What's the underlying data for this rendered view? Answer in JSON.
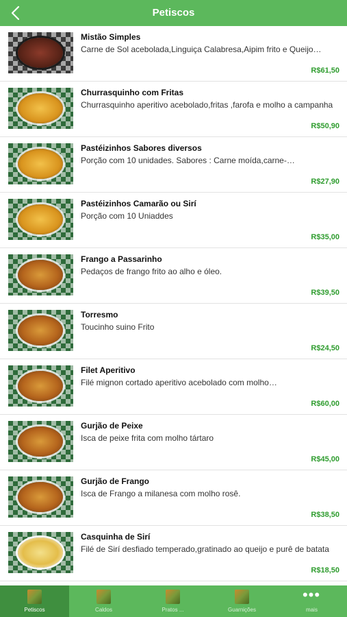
{
  "header": {
    "title": "Petiscos",
    "back_icon": "chevron-left-icon"
  },
  "items": [
    {
      "title": "Mistão Simples",
      "description": "Carne de Sol acebolada,Linguiça Calabresa,Aipim frito e Queijo…",
      "price": "R$61,50"
    },
    {
      "title": "Churrasquinho com Fritas",
      "description": "Churrasquinho aperitivo acebolado,fritas ,farofa e molho a campanha",
      "price": "R$50,90"
    },
    {
      "title": "Pastéizinhos Sabores diversos",
      "description": "Porção com 10 unidades. Sabores : Carne moída,carne-…",
      "price": "R$27,90"
    },
    {
      "title": "Pastéizinhos Camarão ou Sirí",
      "description": "Porção com 10 Uniaddes",
      "price": "R$35,00"
    },
    {
      "title": "Frango a Passarinho",
      "description": "Pedaços de frango frito ao alho e óleo.",
      "price": "R$39,50"
    },
    {
      "title": "Torresmo",
      "description": "Toucinho suino Frito",
      "price": "R$24,50"
    },
    {
      "title": "Filet Aperitivo",
      "description": "Filé mignon cortado aperitivo acebolado com molho…",
      "price": "R$60,00"
    },
    {
      "title": "Gurjão de Peixe",
      "description": "Isca de peixe frita com molho tártaro",
      "price": "R$45,00"
    },
    {
      "title": "Gurjão de Frango",
      "description": "Isca de Frango a milanesa com molho rosê.",
      "price": "R$38,50"
    },
    {
      "title": "Casquinha de Sirí",
      "description": "Filé de Sirí desfiado temperado,gratinado ao queijo e purê de batata",
      "price": "R$18,50"
    }
  ],
  "tabs": [
    {
      "label": "Petiscos",
      "active": true
    },
    {
      "label": "Caldos"
    },
    {
      "label": "Pratos ..."
    },
    {
      "label": "Guarnições"
    },
    {
      "label": "mais"
    }
  ],
  "colors": {
    "brand_green": "#5cb85c",
    "active_tab": "#3f8f3f",
    "price_green": "#2e9c2e"
  }
}
